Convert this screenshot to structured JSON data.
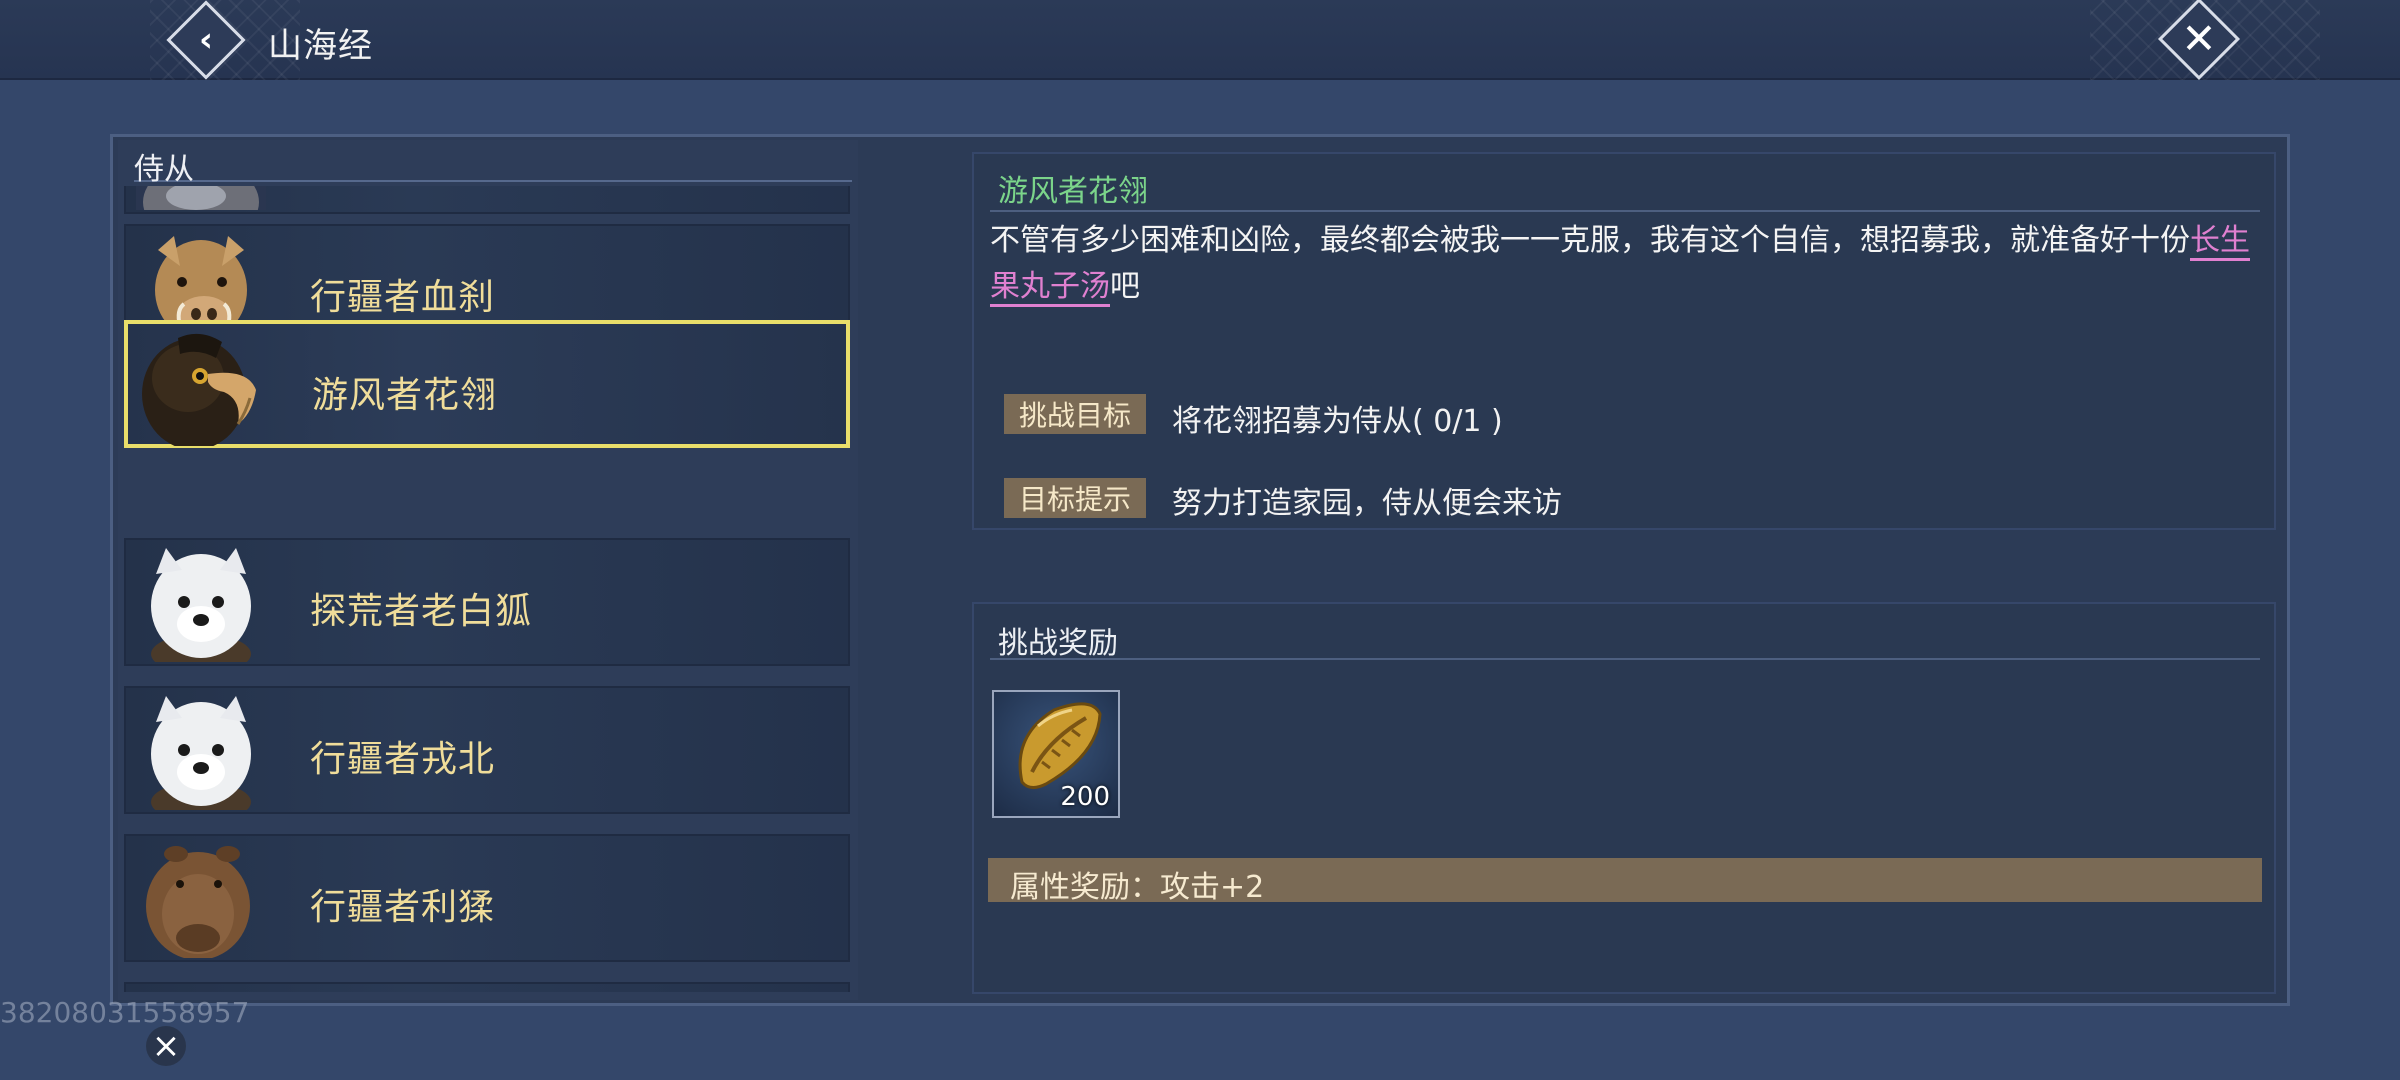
{
  "topbar": {
    "title": "山海经",
    "back_icon": "chevron-left-icon",
    "close_icon": "close-icon"
  },
  "list": {
    "header": "侍从",
    "items": [
      {
        "name": "",
        "portrait": "wolf-portrait",
        "partial": true
      },
      {
        "name": "行疆者血刹",
        "portrait": "boar-portrait"
      },
      {
        "name": "游风者花翎",
        "portrait": "eagle-portrait",
        "selected": true
      },
      {
        "name": "探荒者老白狐",
        "portrait": "white-fox-portrait"
      },
      {
        "name": "行疆者戎北",
        "portrait": "white-fox-portrait"
      },
      {
        "name": "行疆者利猱",
        "portrait": "capybara-portrait"
      },
      {
        "name": "",
        "portrait": "unknown-portrait",
        "partial": true
      }
    ]
  },
  "detail": {
    "title": "游风者花翎",
    "desc_part1": "不管有多少困难和凶险，最终都会被我一一克服，我有这个自信，想招募我，就准备好十份",
    "desc_highlight": "长生果丸子汤",
    "desc_part2": "吧",
    "goal_label": "挑战目标",
    "goal_value": "将花翎招募为侍从( 0/1 )",
    "hint_label": "目标提示",
    "hint_value": "努力打造家园，侍从便会来访"
  },
  "rewards": {
    "header": "挑战奖励",
    "item_icon": "seed-icon",
    "item_count": "200",
    "attr": "属性奖励：攻击+2"
  },
  "watermark": "38208031558957",
  "colors": {
    "selected_border": "#e9de6a",
    "title_green": "#7bd48a",
    "highlight_pink": "#e080d0",
    "tag_brown": "#7a6a55",
    "name_gold": "#f0dd9a"
  }
}
